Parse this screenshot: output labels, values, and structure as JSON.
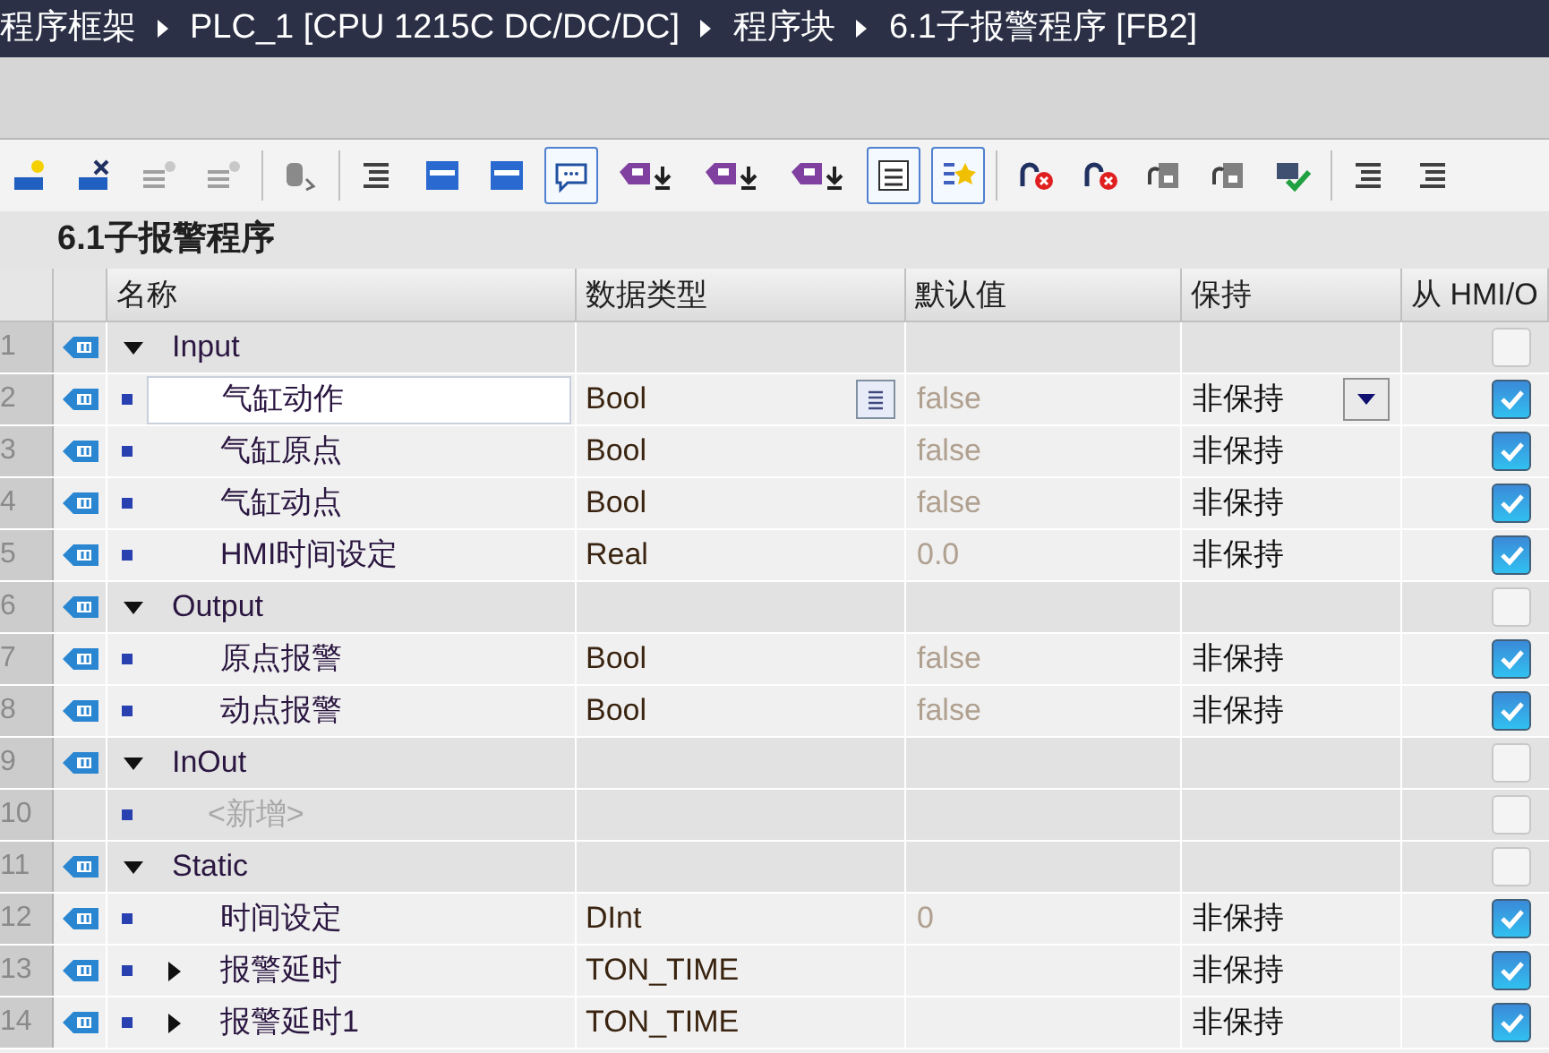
{
  "breadcrumb": [
    "程序框架",
    "PLC_1 [CPU 1215C DC/DC/DC]",
    "程序块",
    "6.1子报警程序 [FB2]"
  ],
  "toolbar": [
    {
      "kind": "insert",
      "pressed": false
    },
    {
      "kind": "delete",
      "pressed": false
    },
    {
      "kind": "dim",
      "pressed": false
    },
    {
      "kind": "dim",
      "pressed": false
    },
    {
      "kind": "sep"
    },
    {
      "kind": "db",
      "pressed": false
    },
    {
      "kind": "sep"
    },
    {
      "kind": "lines",
      "pressed": false
    },
    {
      "kind": "window",
      "pressed": false
    },
    {
      "kind": "window",
      "pressed": false
    },
    {
      "kind": "bubble",
      "pressed": true
    },
    {
      "kind": "tagdown",
      "pressed": false
    },
    {
      "kind": "tagdown",
      "pressed": false
    },
    {
      "kind": "tagdown",
      "pressed": false
    },
    {
      "kind": "list",
      "pressed": true
    },
    {
      "kind": "star",
      "pressed": true
    },
    {
      "kind": "sep"
    },
    {
      "kind": "arrowx",
      "pressed": false
    },
    {
      "kind": "arrowx",
      "pressed": false
    },
    {
      "kind": "monitor",
      "pressed": false
    },
    {
      "kind": "monitor",
      "pressed": false
    },
    {
      "kind": "check",
      "pressed": false
    },
    {
      "kind": "sep"
    },
    {
      "kind": "lines",
      "pressed": false
    },
    {
      "kind": "lines",
      "pressed": false
    }
  ],
  "block_title": "6.1子报警程序",
  "table": {
    "columns": [
      "名称",
      "数据类型",
      "默认值",
      "保持",
      "从 HMI/O"
    ],
    "rows": [
      {
        "kind": "section",
        "number": "1",
        "name": "Input",
        "expanded": true,
        "hmi_checked": false
      },
      {
        "kind": "variable",
        "number": "2",
        "name": "气缸动作",
        "type": "Bool",
        "default": "false",
        "retain": "非保持",
        "hmi_checked": true,
        "selected": true
      },
      {
        "kind": "variable",
        "number": "3",
        "name": "气缸原点",
        "type": "Bool",
        "default": "false",
        "retain": "非保持",
        "hmi_checked": true,
        "selected": false
      },
      {
        "kind": "variable",
        "number": "4",
        "name": "气缸动点",
        "type": "Bool",
        "default": "false",
        "retain": "非保持",
        "hmi_checked": true,
        "selected": false
      },
      {
        "kind": "variable",
        "number": "5",
        "name": "HMI时间设定",
        "type": "Real",
        "default": "0.0",
        "retain": "非保持",
        "hmi_checked": true,
        "selected": false
      },
      {
        "kind": "section",
        "number": "6",
        "name": "Output",
        "expanded": true,
        "hmi_checked": false
      },
      {
        "kind": "variable",
        "number": "7",
        "name": "原点报警",
        "type": "Bool",
        "default": "false",
        "retain": "非保持",
        "hmi_checked": true,
        "selected": false
      },
      {
        "kind": "variable",
        "number": "8",
        "name": "动点报警",
        "type": "Bool",
        "default": "false",
        "retain": "非保持",
        "hmi_checked": true,
        "selected": false
      },
      {
        "kind": "section",
        "number": "9",
        "name": "InOut",
        "expanded": true,
        "hmi_checked": false
      },
      {
        "kind": "add",
        "number": "10",
        "name": "<新增>",
        "hmi_checked": false
      },
      {
        "kind": "section",
        "number": "11",
        "name": "Static",
        "expanded": true,
        "hmi_checked": false
      },
      {
        "kind": "variable",
        "number": "12",
        "name": "时间设定",
        "type": "DInt",
        "default": "0",
        "retain": "非保持",
        "hmi_checked": true,
        "selected": false
      },
      {
        "kind": "struct",
        "number": "13",
        "name": "报警延时",
        "expanded": false,
        "type": "TON_TIME",
        "retain": "非保持",
        "hmi_checked": true,
        "selected": false
      },
      {
        "kind": "struct",
        "number": "14",
        "name": "报警延时1",
        "expanded": false,
        "type": "TON_TIME",
        "retain": "非保持",
        "hmi_checked": true,
        "selected": false
      }
    ]
  }
}
